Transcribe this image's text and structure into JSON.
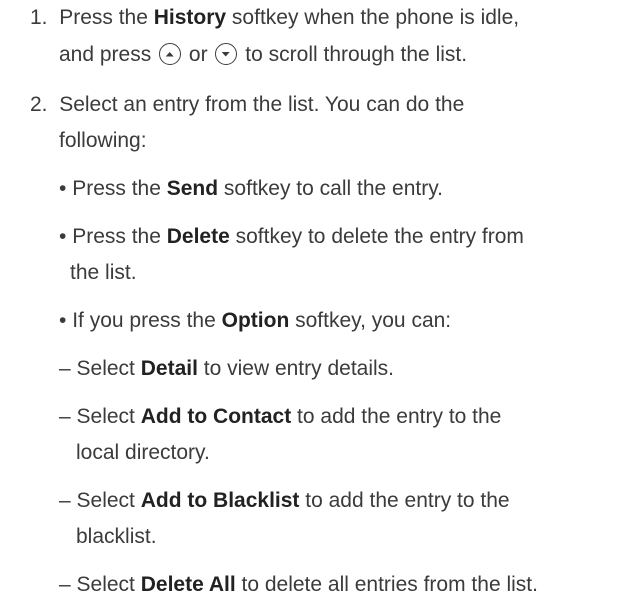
{
  "steps": [
    {
      "num": "1.",
      "line1_pre": "Press the ",
      "line1_bold": "History",
      "line1_post": " softkey when the phone is idle,",
      "line2_pre": "and press",
      "line2_mid": "or",
      "line2_post": "to scroll through the list.",
      "up_key_icon": "circle-up-arrow",
      "down_key_icon": "circle-down-arrow"
    },
    {
      "num": "2.",
      "line1": "Select an entry from the list. You can do the",
      "line2": "following:"
    }
  ],
  "bullets": [
    {
      "marker": "•",
      "pre": "Press the ",
      "bold": "Send",
      "post": " softkey to call the entry.",
      "cont": ""
    },
    {
      "marker": "•",
      "pre": "Press the ",
      "bold": "Delete",
      "post": " softkey to delete the entry from",
      "cont": "the list."
    },
    {
      "marker": "•",
      "pre": "If you press the ",
      "bold": "Option",
      "post": " softkey, you can:",
      "cont": ""
    }
  ],
  "subitems": [
    {
      "marker": "–",
      "pre": "Select ",
      "bold": "Detail",
      "post": " to view entry details.",
      "cont": ""
    },
    {
      "marker": "–",
      "pre": "Select ",
      "bold": "Add to Contact",
      "post": " to add the entry to the",
      "cont": "local directory."
    },
    {
      "marker": "–",
      "pre": "Select ",
      "bold": "Add to Blacklist",
      "post": " to add the entry to the",
      "cont": "blacklist."
    },
    {
      "marker": "–",
      "pre": "Select ",
      "bold": "Delete All",
      "post": " to delete all entries from the list.",
      "cont": ""
    }
  ]
}
